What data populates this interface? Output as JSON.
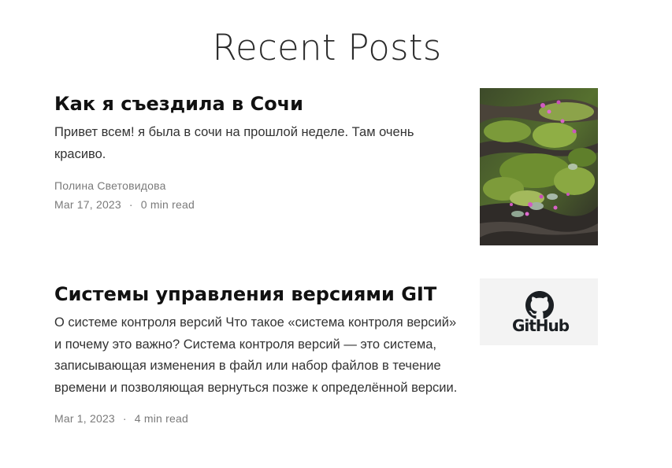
{
  "section": {
    "title": "Recent Posts"
  },
  "posts": [
    {
      "title": "Как я съездила в Сочи",
      "excerpt": "Привет всем! я была в сочи на прошлой неделе. Там очень красиво.",
      "author": "Полина Световидова",
      "date": "Mar 17, 2023",
      "separator": "·",
      "read_time": "0 min read",
      "image": "moss-and-flowers-photo"
    },
    {
      "title": "Системы управления версиями GIT",
      "excerpt": "О системе контроля версий Что такое «система контроля версий» и почему это важно? Система контроля версий — это система, записывающая изменения в файл или набор файлов в течение времени и позволяющая вернуться позже к определённой версии.",
      "date": "Mar 1, 2023",
      "separator": "·",
      "read_time": "4 min read",
      "image": "github-logo",
      "image_text": "GitHub"
    }
  ],
  "colors": {
    "title_text": "#111111",
    "body_text": "#333333",
    "meta_text": "#7a7a7a",
    "github_bg": "#f3f3f3"
  }
}
